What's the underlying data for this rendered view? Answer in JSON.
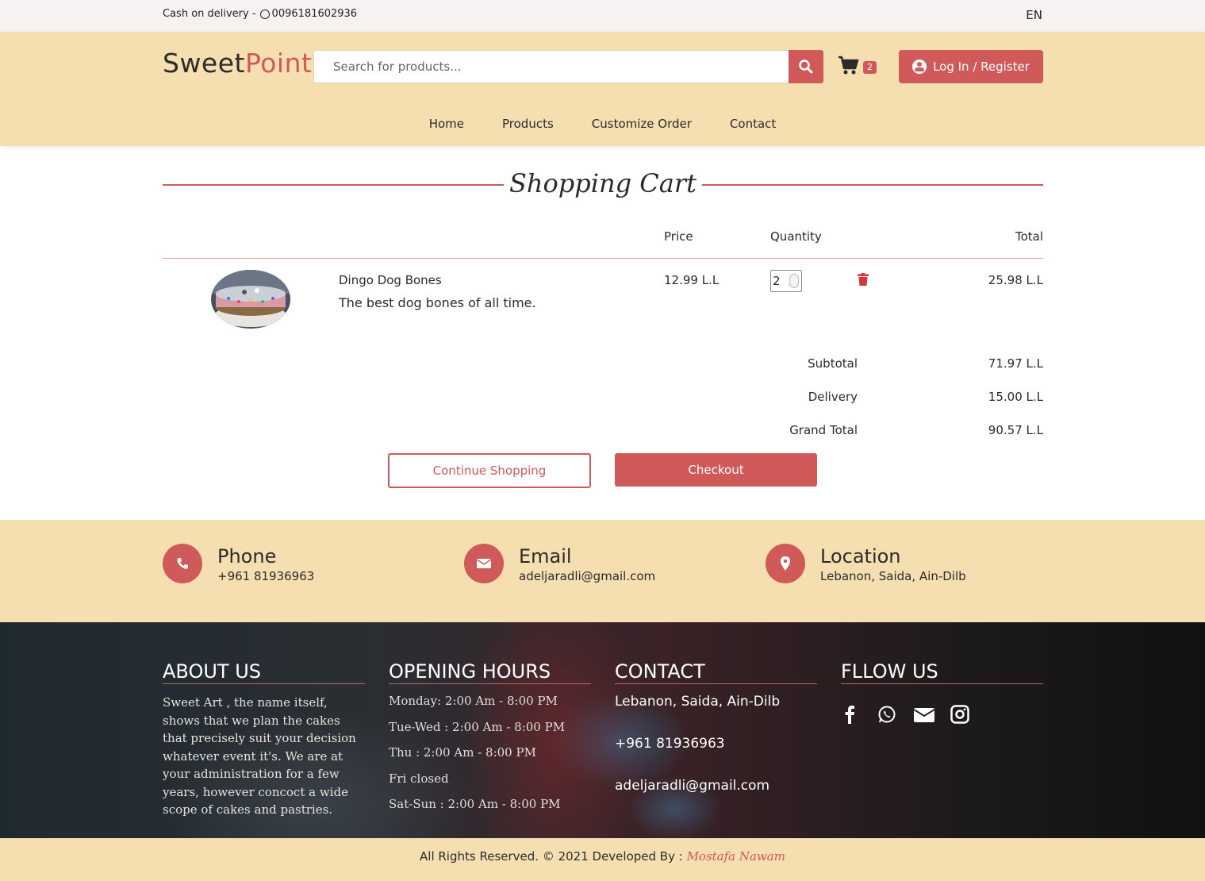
{
  "topbar": {
    "text": "Cash on delivery -",
    "phone": "0096181602936",
    "language": "EN"
  },
  "brand": {
    "part1": "Sweet",
    "part2": "Point",
    "accent_color": "#d05a5a",
    "header_bg": "#f5deb0"
  },
  "search": {
    "placeholder": "Search for products..."
  },
  "cart": {
    "count": "2"
  },
  "login": {
    "label": "Log In / Register"
  },
  "nav": {
    "items": [
      "Home",
      "Products",
      "Customize Order",
      "Contact"
    ]
  },
  "page": {
    "title": "Shopping Cart"
  },
  "table": {
    "headers": {
      "price": "Price",
      "quantity": "Quantity",
      "total": "Total"
    },
    "items": [
      {
        "name": "Dingo Dog Bones",
        "description": "The best dog bones of all time.",
        "price": "12.99 L.L",
        "quantity": "2",
        "total": "25.98 L.L"
      }
    ]
  },
  "summary": {
    "subtotal_label": "Subtotal",
    "subtotal_value": "71.97 L.L",
    "delivery_label": "Delivery",
    "delivery_value": "15.00 L.L",
    "grand_label": "Grand Total",
    "grand_value": "90.57 L.L"
  },
  "actions": {
    "continue": "Continue Shopping",
    "checkout": "Checkout"
  },
  "contact_band": {
    "phone_title": "Phone",
    "phone_value": "+961 81936963",
    "email_title": "Email",
    "email_value": "adeljaradli@gmail.com",
    "location_title": "Location",
    "location_value": "Lebanon, Saida, Ain-Dilb"
  },
  "footer": {
    "about_title": "ABOUT US",
    "about_text": "Sweet Art , the name itself, shows that we plan the cakes that precisely suit your decision whatever event it's. We are at your administration for a few years, however concoct a wide scope of cakes and pastries.",
    "hours_title": "OPENING HOURS",
    "hours": [
      "Monday: 2:00 Am - 8:00 PM",
      "Tue-Wed : 2:00 Am - 8:00 PM",
      "Thu : 2:00 Am - 8:00 PM",
      "Fri closed",
      "Sat-Sun : 2:00 Am - 8:00 PM"
    ],
    "contact_title": "CONTACT",
    "contact_address": "Lebanon, Saida, Ain-Dilb",
    "contact_phone": "+961 81936963",
    "contact_email": "adeljaradli@gmail.com",
    "follow_title": "FLLOW US",
    "social_icons": [
      "facebook-icon",
      "whatsapp-icon",
      "envelope-icon",
      "instagram-icon"
    ]
  },
  "bottom": {
    "rights": "All Rights Reserved. © 2021 Developed By :",
    "developer": "Mostafa Nawam"
  }
}
